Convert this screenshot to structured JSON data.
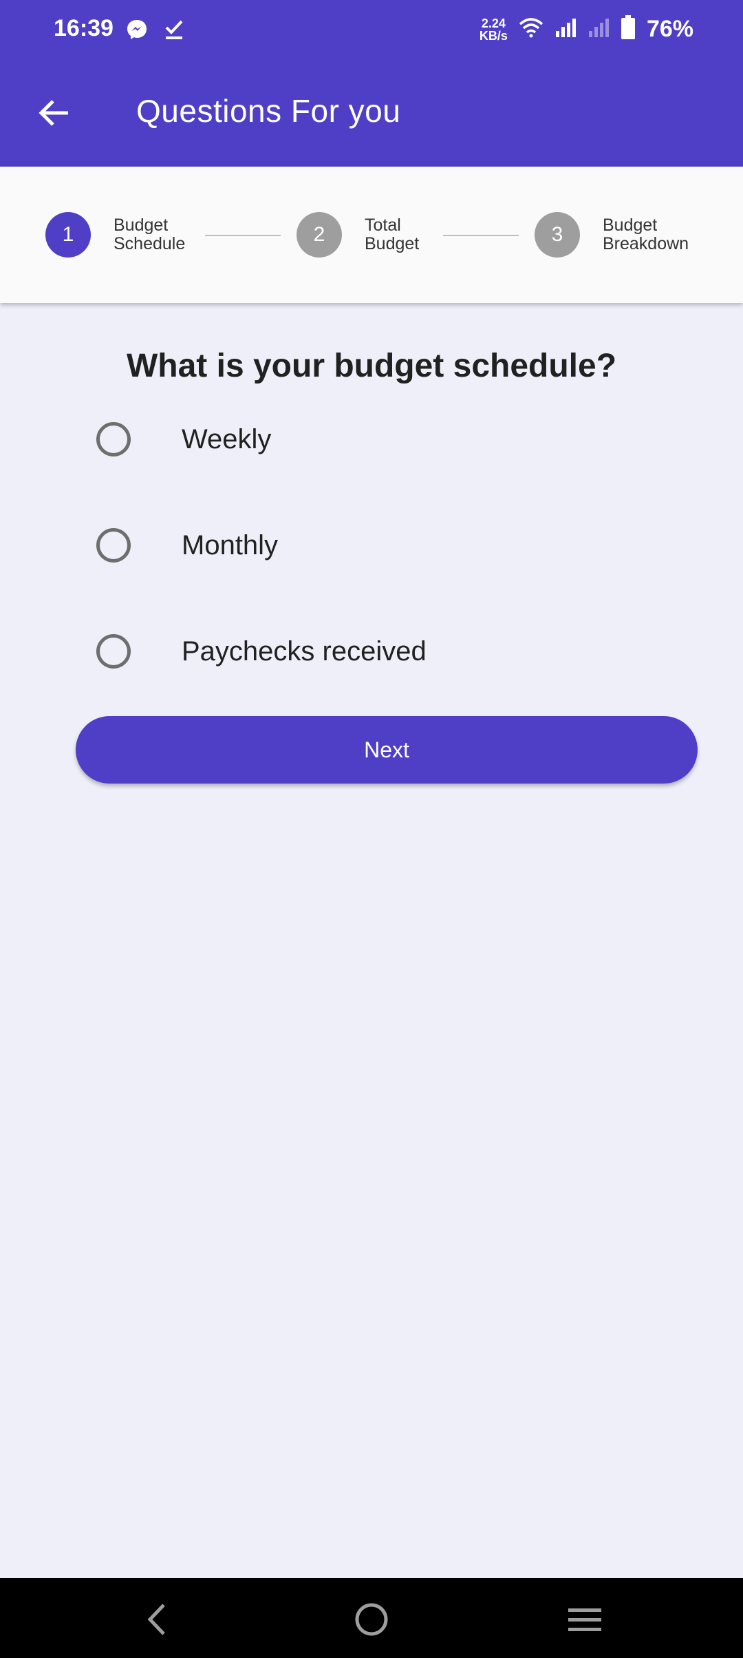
{
  "status_bar": {
    "time": "16:39",
    "net_speed_value": "2.24",
    "net_speed_unit": "KB/s",
    "battery": "76%",
    "icons": [
      "messenger-icon",
      "check-icon",
      "wifi-icon",
      "signal-icon",
      "signal-weak-icon",
      "battery-icon"
    ]
  },
  "app_bar": {
    "title": "Questions For you",
    "back_icon": "arrow-left-icon"
  },
  "stepper": {
    "steps": [
      {
        "number": "1",
        "line1": "Budget",
        "line2": "Schedule",
        "state": "active"
      },
      {
        "number": "2",
        "line1": "Total",
        "line2": "Budget",
        "state": "inactive"
      },
      {
        "number": "3",
        "line1": "Budget",
        "line2": "Breakdown",
        "state": "inactive"
      }
    ]
  },
  "question": "What is your budget schedule?",
  "options": [
    {
      "label": "Weekly",
      "selected": false
    },
    {
      "label": "Monthly",
      "selected": false
    },
    {
      "label": "Paychecks received",
      "selected": false
    }
  ],
  "next_button": "Next",
  "colors": {
    "primary": "#4f3fc7",
    "background": "#efeff9",
    "inactive_step": "#9e9e9e"
  },
  "nav_bar": {
    "icons": [
      "back-nav-icon",
      "home-nav-icon",
      "recents-nav-icon"
    ]
  }
}
